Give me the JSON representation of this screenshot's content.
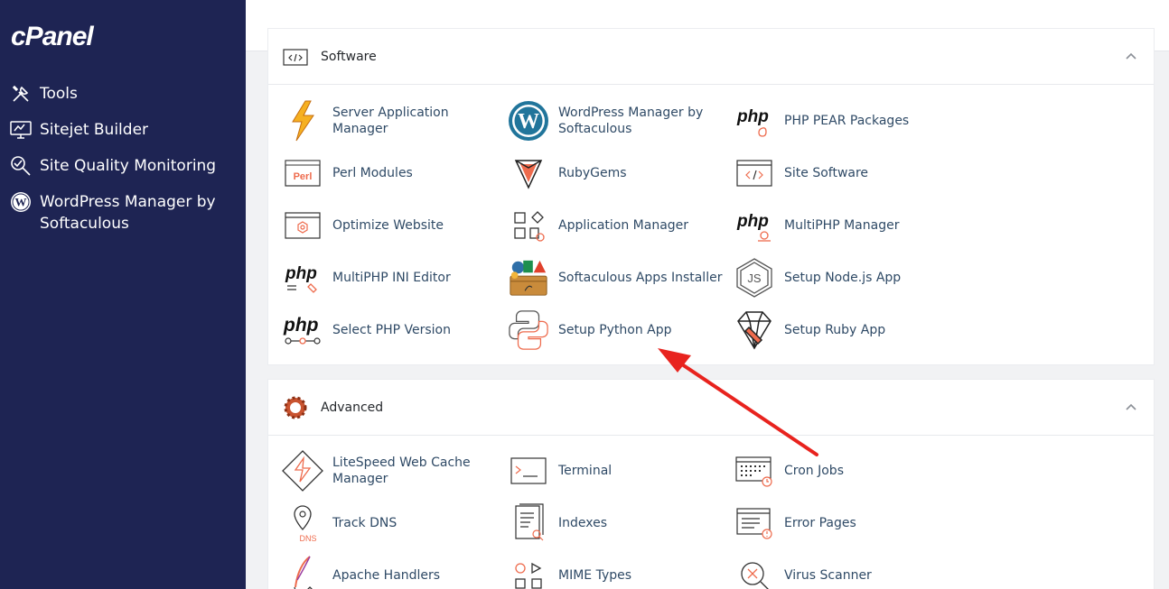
{
  "sidebar": {
    "logo": "cPanel",
    "items": [
      {
        "label": "Tools",
        "icon": "tools-icon"
      },
      {
        "label": "Sitejet Builder",
        "icon": "sitejet-icon"
      },
      {
        "label": "Site Quality Monitoring",
        "icon": "site-quality-icon"
      },
      {
        "label": "WordPress Manager by Softaculous",
        "icon": "wordpress-icon"
      }
    ]
  },
  "software": {
    "title": "Software",
    "items": [
      {
        "label": "Server Application Manager",
        "icon": "lightning-icon"
      },
      {
        "label": "WordPress Manager by Softaculous",
        "icon": "wordpress-icon"
      },
      {
        "label": "PHP PEAR Packages",
        "icon": "php-pear-icon"
      },
      {
        "label": "Perl Modules",
        "icon": "perl-icon"
      },
      {
        "label": "RubyGems",
        "icon": "rubygems-icon"
      },
      {
        "label": "Site Software",
        "icon": "code-icon"
      },
      {
        "label": "Optimize Website",
        "icon": "optimize-icon"
      },
      {
        "label": "Application Manager",
        "icon": "app-manager-icon"
      },
      {
        "label": "MultiPHP Manager",
        "icon": "multiphp-icon"
      },
      {
        "label": "MultiPHP INI Editor",
        "icon": "php-ini-icon"
      },
      {
        "label": "Softaculous Apps Installer",
        "icon": "softaculous-icon"
      },
      {
        "label": "Setup Node.js App",
        "icon": "nodejs-icon"
      },
      {
        "label": "Select PHP Version",
        "icon": "php-version-icon"
      },
      {
        "label": "Setup Python App",
        "icon": "python-icon"
      },
      {
        "label": "Setup Ruby App",
        "icon": "ruby-icon"
      }
    ],
    "php_word": "php",
    "perl_word": "Perl"
  },
  "advanced": {
    "title": "Advanced",
    "items": [
      {
        "label": "LiteSpeed Web Cache Manager",
        "icon": "litespeed-icon"
      },
      {
        "label": "Terminal",
        "icon": "terminal-icon"
      },
      {
        "label": "Cron Jobs",
        "icon": "cron-icon"
      },
      {
        "label": "Track DNS",
        "icon": "track-dns-icon"
      },
      {
        "label": "Indexes",
        "icon": "indexes-icon"
      },
      {
        "label": "Error Pages",
        "icon": "error-pages-icon"
      },
      {
        "label": "Apache Handlers",
        "icon": "apache-icon"
      },
      {
        "label": "MIME Types",
        "icon": "mime-icon"
      },
      {
        "label": "Virus Scanner",
        "icon": "virus-scanner-icon"
      }
    ],
    "dns_word": "DNS"
  },
  "colors": {
    "sidebar": "#1e2453",
    "accent": "#ee6b4d",
    "arrow": "#e8231e",
    "link": "#2f4a66"
  }
}
